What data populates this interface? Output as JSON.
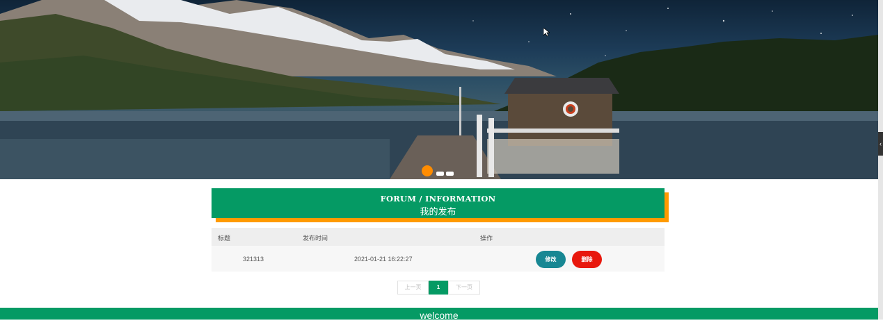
{
  "banner": {
    "slides_total": 3,
    "active_slide": 1
  },
  "section": {
    "title_en": "FORUM / INFORMATION",
    "title_cn": "我的发布"
  },
  "table": {
    "headers": [
      "标题",
      "发布时间",
      "操作"
    ],
    "rows": [
      {
        "title": "321313",
        "time": "2021-01-21 16:22:27",
        "edit_label": "修改",
        "delete_label": "删除"
      }
    ]
  },
  "pagination": {
    "prev_label": "上一页",
    "current_page": "1",
    "next_label": "下一页"
  },
  "footer": {
    "text": "welcome"
  },
  "colors": {
    "primary_green": "#059a64",
    "accent_orange": "#ff9a00",
    "edit_teal": "#178793",
    "delete_red": "#e8180d"
  },
  "icons": [
    "cursor-pointer-icon",
    "collapse-chevron-icon"
  ]
}
